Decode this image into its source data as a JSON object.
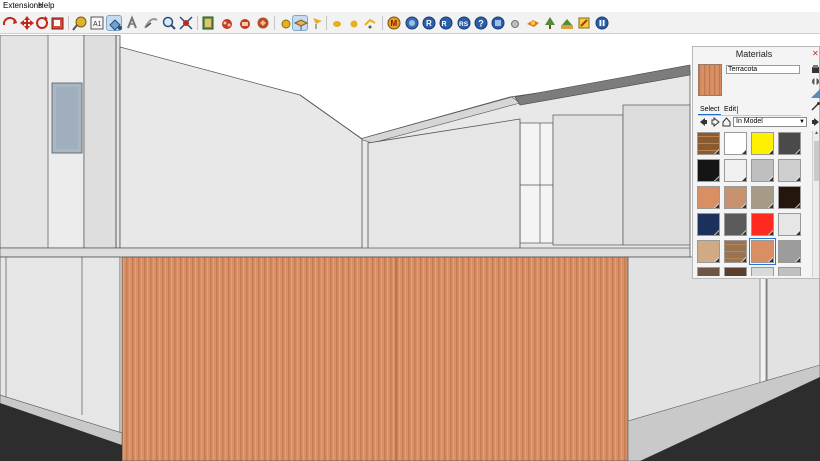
{
  "menu": {
    "items": [
      "Extensions",
      "Help"
    ]
  },
  "toolbar": {
    "tools": [
      {
        "name": "orbit-icon"
      },
      {
        "name": "pan-icon"
      },
      {
        "name": "rotate-icon"
      },
      {
        "name": "scale-icon"
      },
      {
        "name": "tape-measure-icon"
      },
      {
        "name": "dimension-icon"
      },
      {
        "name": "paint-bucket-icon"
      },
      {
        "name": "walk-icon"
      },
      {
        "name": "zoom-icon"
      },
      {
        "name": "zoom-extents-icon"
      },
      {
        "name": "component-browser-icon"
      },
      {
        "name": "warehouse-icon"
      },
      {
        "name": "extension-icon"
      },
      {
        "name": "sphere-icon"
      },
      {
        "name": "sandbox-icon"
      },
      {
        "name": "flag-icon"
      },
      {
        "name": "dot-small-icon"
      },
      {
        "name": "dot-icon"
      },
      {
        "name": "arrow-tool-icon"
      },
      {
        "name": "model-info-icon"
      },
      {
        "name": "layer-icon"
      },
      {
        "name": "shadow-icon"
      },
      {
        "name": "fog-icon"
      },
      {
        "name": "help-icon"
      },
      {
        "name": "extension-warehouse-icon"
      },
      {
        "name": "gem-icon"
      },
      {
        "name": "bee-icon"
      },
      {
        "name": "palm-icon"
      },
      {
        "name": "tree-icon"
      },
      {
        "name": "pause-icon"
      }
    ],
    "active_tool": "sandbox-icon"
  },
  "materials_panel": {
    "title": "Materials",
    "current_material": "Terracota",
    "tabs": [
      "Select",
      "Edit"
    ],
    "active_tab": "Select",
    "collection": "In Model",
    "swatches": [
      {
        "color": "#8a5a30",
        "texture": "wood"
      },
      {
        "color": "#ffffff"
      },
      {
        "color": "#fff000"
      },
      {
        "color": "#4a4a4a"
      },
      {
        "color": "#151515"
      },
      {
        "color": "#f0f0f0"
      },
      {
        "color": "#bfbfbf"
      },
      {
        "color": "#cfcfcf"
      },
      {
        "color": "#d98e64"
      },
      {
        "color": "#c9926e"
      },
      {
        "color": "#a79a86"
      },
      {
        "color": "#24150d"
      },
      {
        "color": "#1c305c"
      },
      {
        "color": "#5a5a5a"
      },
      {
        "color": "#ff2a1f"
      },
      {
        "color": "#e6e6e6"
      },
      {
        "color": "#d0aa85"
      },
      {
        "color": "#9a7354",
        "texture": "wood"
      },
      {
        "color": "#d98e64",
        "selected": true
      },
      {
        "color": "#9c9c9c"
      },
      {
        "color": "#6e5644"
      },
      {
        "color": "#5b3f2c"
      },
      {
        "color": "#d9d9d9"
      },
      {
        "color": "#c0c0c0"
      }
    ]
  },
  "colors": {
    "terracotta": "#d98e64",
    "wall_light": "#e6e6e6",
    "wall_shadow": "#cfcfcf",
    "road": "#2d2d2d",
    "accent_selection": "#2b75d6"
  }
}
